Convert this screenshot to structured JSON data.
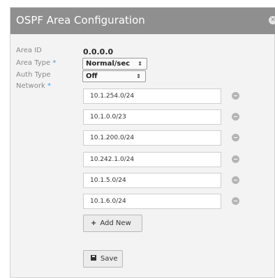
{
  "dialog": {
    "title": "OSPF Area Configuration",
    "close_icon": "close-icon"
  },
  "form": {
    "area_id_label": "Area ID",
    "area_id_value": "0.0.0.0",
    "area_type_label": "Area Type",
    "area_type_required": "*",
    "area_type_value": "Normal/sec",
    "auth_type_label": "Auth Type",
    "auth_type_value": "Off",
    "network_label": "Network",
    "network_required": "*",
    "networks": [
      "10.1.254.0/24",
      "10.1.0.0/23",
      "10.1.200.0/24",
      "10.242.1.0/24",
      "10.1.5.0/24",
      "10.1.6.0/24"
    ]
  },
  "buttons": {
    "add_new_label": "Add New",
    "save_label": "Save"
  }
}
